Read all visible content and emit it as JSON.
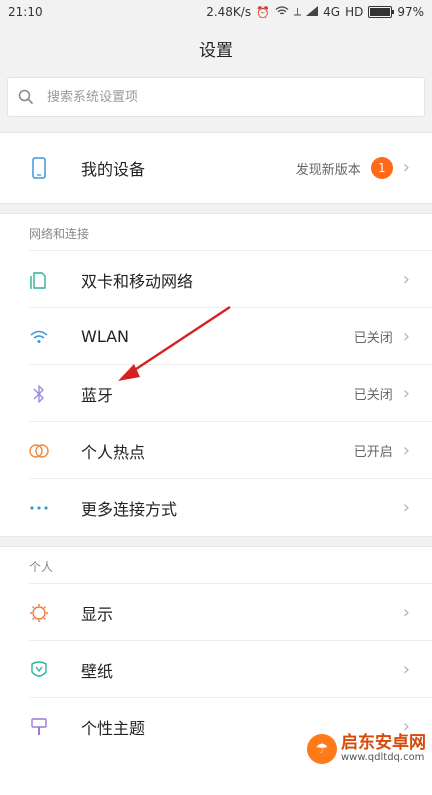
{
  "status": {
    "time": "21:10",
    "speed": "2.48K/s",
    "network": "4G",
    "hd": "HD",
    "battery_percent": "97%",
    "battery_level": 0.97
  },
  "title": "设置",
  "search": {
    "placeholder": "搜索系统设置项"
  },
  "device": {
    "label": "我的设备",
    "status": "发现新版本",
    "badge": "1"
  },
  "sections": {
    "network": {
      "title": "网络和连接",
      "items": [
        {
          "label": "双卡和移动网络",
          "status": ""
        },
        {
          "label": "WLAN",
          "status": "已关闭"
        },
        {
          "label": "蓝牙",
          "status": "已关闭"
        },
        {
          "label": "个人热点",
          "status": "已开启"
        },
        {
          "label": "更多连接方式",
          "status": ""
        }
      ]
    },
    "personal": {
      "title": "个人",
      "items": [
        {
          "label": "显示"
        },
        {
          "label": "壁纸"
        },
        {
          "label": "个性主题"
        }
      ]
    }
  },
  "icons": {
    "device": "phone-icon",
    "dual_sim": "sim-card-icon",
    "wlan": "wifi-icon",
    "bluetooth": "bluetooth-icon",
    "hotspot": "hotspot-icon",
    "more": "more-dots-icon",
    "display": "brightness-icon",
    "wallpaper": "wallpaper-icon",
    "theme": "theme-brush-icon"
  },
  "colors": {
    "accent_badge": "#ff6a1a",
    "annotation_arrow": "#d42222",
    "device_icon": "#3a9ad9",
    "bluetooth_icon": "#9b8de0",
    "hotspot_icon": "#f08a3a",
    "display_icon": "#f07a3a",
    "wallpaper_icon": "#2bb39a",
    "theme_icon": "#9b79d6"
  },
  "watermark": {
    "title": "启东安卓网",
    "url": "www.qdltdq.com"
  }
}
